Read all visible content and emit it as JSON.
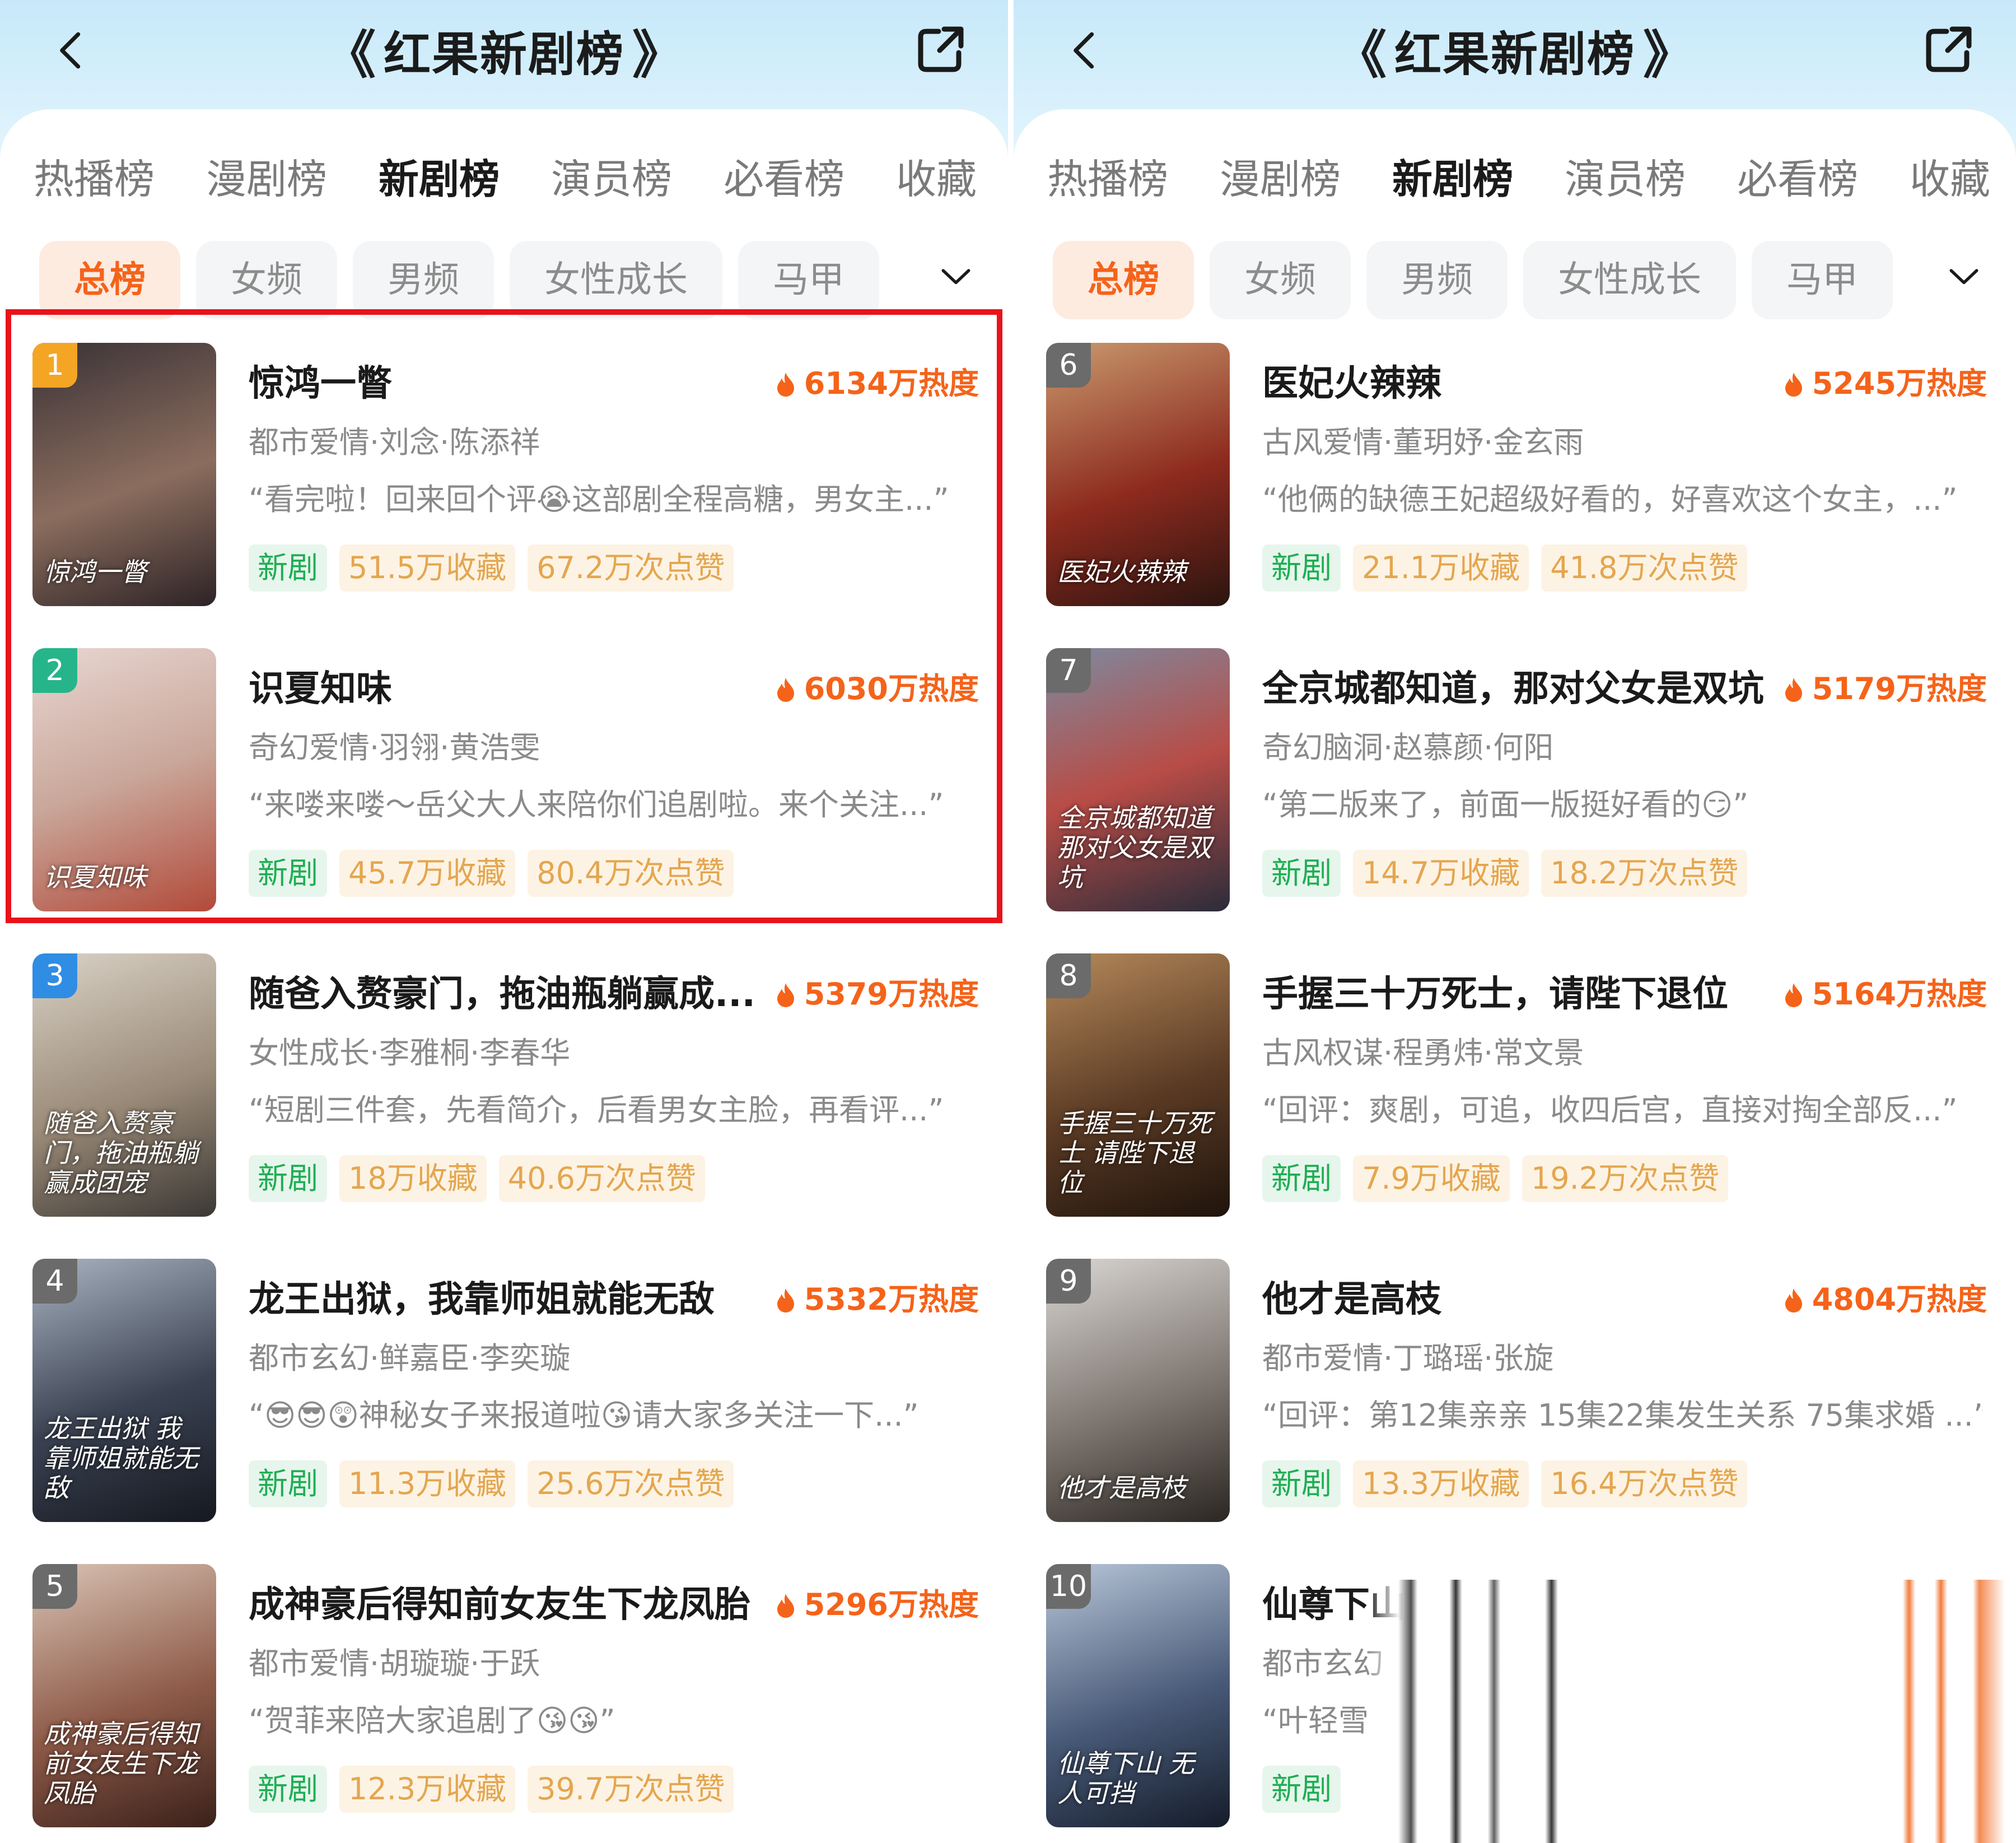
{
  "left": {
    "header": {
      "title": "红果新剧榜",
      "laurel_left": "《",
      "laurel_right": "》"
    },
    "tabs": [
      "热播榜",
      "漫剧榜",
      "新剧榜",
      "演员榜",
      "必看榜",
      "收藏"
    ],
    "active_tab": 2,
    "chips": [
      "总榜",
      "女频",
      "男频",
      "女性成长",
      "马甲"
    ],
    "active_chip": 0,
    "items": [
      {
        "rank": "1",
        "rank_color": "#f5a524",
        "poster_bg": "linear-gradient(160deg,#3a3236,#8b6d5e 55%,#2d2326)",
        "poster_text": "惊鸿一瞥",
        "title": "惊鸿一瞥",
        "heat": "6134万热度",
        "meta": "都市爱情·刘念·陈添祥",
        "review": "“看完啦！回来回个评😭这部剧全程高糖，男女主...”",
        "tags": [
          "新剧",
          "51.5万收藏",
          "67.2万次点赞"
        ]
      },
      {
        "rank": "2",
        "rank_color": "#26b58a",
        "poster_bg": "linear-gradient(160deg,#e8d6d2,#c9a79a 50%,#b24a3a)",
        "poster_text": "识夏知味",
        "title": "识夏知味",
        "heat": "6030万热度",
        "meta": "奇幻爱情·羽翎·黄浩雯",
        "review": "“来喽来喽～岳父大人来陪你们追剧啦。来个关注...”",
        "tags": [
          "新剧",
          "45.7万收藏",
          "80.4万次点赞"
        ]
      },
      {
        "rank": "3",
        "rank_color": "#2f8de4",
        "poster_bg": "linear-gradient(160deg,#d9d2c6,#9a8a78 55%,#3b3834)",
        "poster_text": "随爸入赘豪门，拖油瓶躺赢成团宠",
        "title": "随爸入赘豪门，拖油瓶躺赢成...",
        "heat": "5379万热度",
        "meta": "女性成长·李雅桐·李春华",
        "review": "“短剧三件套，先看简介，后看男女主脸，再看评...”",
        "tags": [
          "新剧",
          "18万收藏",
          "40.6万次点赞"
        ]
      },
      {
        "rank": "4",
        "rank_color": "#6b6b6b",
        "poster_bg": "linear-gradient(160deg,#a9b3c0,#3a4252 55%,#15181f)",
        "poster_text": "龙王出狱 我靠师姐就能无敌",
        "title": "龙王出狱，我靠师姐就能无敌",
        "heat": "5332万热度",
        "meta": "都市玄幻·鲜嘉臣·李奕璇",
        "review": "“😎😎😲神秘女子来报道啦😘请大家多关注一下...”",
        "tags": [
          "新剧",
          "11.3万收藏",
          "25.6万次点赞"
        ]
      },
      {
        "rank": "5",
        "rank_color": "#6b6b6b",
        "poster_bg": "linear-gradient(160deg,#d8c3b4,#8e5a48 55%,#3a211b)",
        "poster_text": "成神豪后得知前女友生下龙凤胎",
        "title": "成神豪后得知前女友生下龙凤胎",
        "heat": "5296万热度",
        "meta": "都市爱情·胡璇璇·于跃",
        "review": "“贺菲来陪大家追剧了😘😘”",
        "tags": [
          "新剧",
          "12.3万收藏",
          "39.7万次点赞"
        ]
      }
    ]
  },
  "right": {
    "header": {
      "title": "红果新剧榜",
      "laurel_left": "《",
      "laurel_right": "》"
    },
    "tabs": [
      "热播榜",
      "漫剧榜",
      "新剧榜",
      "演员榜",
      "必看榜",
      "收藏"
    ],
    "active_tab": 2,
    "chips": [
      "总榜",
      "女频",
      "男频",
      "女性成长",
      "马甲"
    ],
    "active_chip": 0,
    "items": [
      {
        "rank": "6",
        "rank_color": "#6b6b6b",
        "poster_bg": "linear-gradient(160deg,#c99a6e,#8d2a1e 55%,#2b1410)",
        "poster_text": "医妃火辣辣",
        "title": "医妃火辣辣",
        "heat": "5245万热度",
        "meta": "古风爱情·董玥妤·金玄雨",
        "review": "“他俩的缺德王妃超级好看的，好喜欢这个女主，...”",
        "tags": [
          "新剧",
          "21.1万收藏",
          "41.8万次点赞"
        ]
      },
      {
        "rank": "7",
        "rank_color": "#6b6b6b",
        "poster_bg": "linear-gradient(160deg,#7d8aa0,#b84c46 50%,#2a2c3a)",
        "poster_text": "全京城都知道 那对父女是双坑",
        "title": "全京城都知道，那对父女是双坑",
        "heat": "5179万热度",
        "meta": "奇幻脑洞·赵慕颜·何阳",
        "review": "“第二版来了，前面一版挺好看的😏”",
        "tags": [
          "新剧",
          "14.7万收藏",
          "18.2万次点赞"
        ]
      },
      {
        "rank": "8",
        "rank_color": "#6b6b6b",
        "poster_bg": "linear-gradient(160deg,#b5895a,#5a3a24 55%,#1e130c)",
        "poster_text": "手握三十万死士 请陛下退位",
        "title": "手握三十万死士，请陛下退位",
        "heat": "5164万热度",
        "meta": "古风权谋·程勇炜·常文景",
        "review": "“回评：爽剧，可追，收四后宫，直接对掏全部反...”",
        "tags": [
          "新剧",
          "7.9万收藏",
          "19.2万次点赞"
        ]
      },
      {
        "rank": "9",
        "rank_color": "#6b6b6b",
        "poster_bg": "linear-gradient(160deg,#d9d6d3,#7e7670 55%,#2b2622)",
        "poster_text": "他才是高枝",
        "title": "他才是高枝",
        "heat": "4804万热度",
        "meta": "都市爱情·丁璐瑶·张旋",
        "review": "“回评：第12集亲亲 15集22集发生关系 75集求婚 ...”",
        "tags": [
          "新剧",
          "13.3万收藏",
          "16.4万次点赞"
        ]
      },
      {
        "rank": "10",
        "rank_color": "#6b6b6b",
        "poster_bg": "linear-gradient(160deg,#b8c6d8,#485a78 55%,#151c2a)",
        "poster_text": "仙尊下山 无人可挡",
        "title": "仙尊下山",
        "heat": "",
        "meta": "都市玄幻",
        "review": "“叶轻雪",
        "tags": [
          "新剧"
        ]
      }
    ]
  },
  "colors": {
    "accent": "#f5631a",
    "highlight_border": "#e8131b",
    "tag_new": "#1fae54",
    "tag_stat": "#e4a64f"
  },
  "icons": {
    "back": "chevron-left-icon",
    "share": "share-icon",
    "filter": "chevron-down-icon",
    "heat": "flame-icon"
  }
}
